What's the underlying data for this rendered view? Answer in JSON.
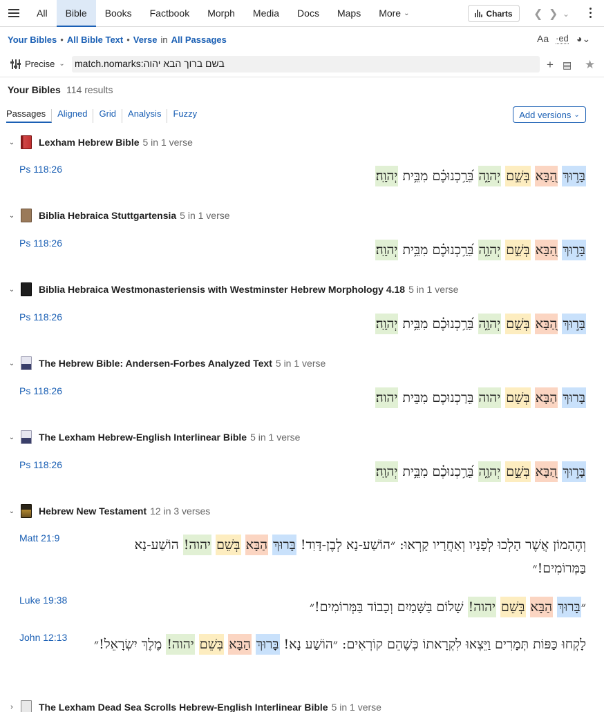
{
  "toolbar": {
    "tabs": [
      "All",
      "Bible",
      "Books",
      "Factbook",
      "Morph",
      "Media",
      "Docs",
      "Maps",
      "More"
    ],
    "active_tab": "Bible",
    "charts_label": "Charts"
  },
  "scope": {
    "bibles": "Your Bibles",
    "text": "All Bible Text",
    "unit": "Verse",
    "in_word": "in",
    "range": "All Passages",
    "tool_font": "Aa",
    "tool_ed": "·ed"
  },
  "search": {
    "mode": "Precise",
    "query": "match.nomarks:בשם ברוך הבא יהוה"
  },
  "results": {
    "title": "Your Bibles",
    "count": "114 results",
    "views": [
      "Passages",
      "Aligned",
      "Grid",
      "Analysis",
      "Fuzzy"
    ],
    "active_view": "Passages",
    "add_versions": "Add versions"
  },
  "groups": [
    {
      "title": "Lexham Hebrew Bible",
      "count": "5 in 1 verse",
      "rows": [
        {
          "ref": "Ps 118:26",
          "text": [
            "בָּר֣וּךְ",
            "הַ֭בָּא",
            "בְּשֵׁ֣ם",
            "יְהוָ֑ה",
            "בֵּ֝רַ֥כְנוּכֶ֗ם מִבֵּ֥ית",
            "יְהוָֽה׃"
          ]
        }
      ]
    },
    {
      "title": "Biblia Hebraica Stuttgartensia",
      "count": "5 in 1 verse",
      "rows": [
        {
          "ref": "Ps 118:26",
          "text": [
            "בָּר֣וּךְ",
            "הַ֭בָּא",
            "בְּשֵׁ֣ם",
            "יְהוָ֑ה",
            "בֵּ֝רַ֥כְנוּכֶ֗ם מִבֵּ֥ית",
            "יְהוָֽה׃"
          ]
        }
      ]
    },
    {
      "title": "Biblia Hebraica Westmonasteriensis with Westminster Hebrew Morphology 4.18",
      "count": "5 in 1 verse",
      "rows": [
        {
          "ref": "Ps 118:26",
          "text": [
            "בָּר֣וּךְ",
            "הַ֭בָּא",
            "בְּשֵׁ֣ם",
            "יְהוָ֑ה",
            "בֵּ֝רַ֥כְנוּכֶ֗ם מִבֵּ֥ית",
            "יְהוָֽה׃"
          ]
        }
      ]
    },
    {
      "title": "The Hebrew Bible: Andersen-Forbes Analyzed Text",
      "count": "5 in 1 verse",
      "rows": [
        {
          "ref": "Ps 118:26",
          "text": [
            "בָּרוּךְ",
            "הַבָּא",
            "בְּשֵׁם",
            "יהוה",
            "בֵּרַכְנוּכֶם מִבֵּית",
            "יהוה׃"
          ]
        }
      ]
    },
    {
      "title": "The Lexham Hebrew-English Interlinear Bible",
      "count": "5 in 1 verse",
      "rows": [
        {
          "ref": "Ps 118:26",
          "text": [
            "בָּר֣וּךְ",
            "הַ֭בָּא",
            "בְּשֵׁ֣ם",
            "יְהוָ֑ה",
            "בֵּ֝רַ֥כְנוּכֶ֗ם מִבֵּ֥ית",
            "יְהוָֽה׃"
          ]
        }
      ]
    },
    {
      "title": "Hebrew New Testament",
      "count": "12 in 3 verses",
      "rows": [
        {
          "ref": "Matt 21:9",
          "text": [
            "וְהֶהָמוֹן אֲשֶׁר הָלְכוּ לְפָנָיו וְאַחֲרָיו קָרְאוּ: ״הוֹשַׁע-נָא לְבֶן-דָּוִד!",
            "בָּרוּךְ",
            "הַבָּא",
            "בְּשֵׁם",
            "יהוה!",
            "הוֹשַׁע-נָא בַּמְּרוֹמִים!״"
          ]
        },
        {
          "ref": "Luke 19:38",
          "text": [
            "״",
            "בָּרוּךְ",
            "הַבָּא",
            "בְּשֵׁם",
            "יהוה!",
            "שָׁלוֹם בַּשָּׁמַיִם וְכָבוֹד בַּמְּרוֹמִים!״"
          ]
        },
        {
          "ref": "John 12:13",
          "text": [
            "לָקְחוּ כַּפּוֹת תְּמָרִים וַיֵּצְאוּ לִקְרָאתוֹ כְּשֶׁהֵם קוֹרְאִים: ״הוֹשַׁע נָא!",
            "בָּרוּךְ",
            "הַבָּא",
            "בְּשֵׁם",
            "יהוה!",
            "מֶלֶךְ יִשְׂרָאֵל!״"
          ]
        }
      ]
    },
    {
      "title": "The Lexham Dead Sea Scrolls Hebrew-English Interlinear Bible",
      "count": "5 in 1 verse",
      "rows": []
    }
  ],
  "highlight_colors": {
    "baruch": "#c9e1fb",
    "haba": "#fbd5c2",
    "beshem": "#fdedc0",
    "yhwh": "#e1f0d4"
  }
}
